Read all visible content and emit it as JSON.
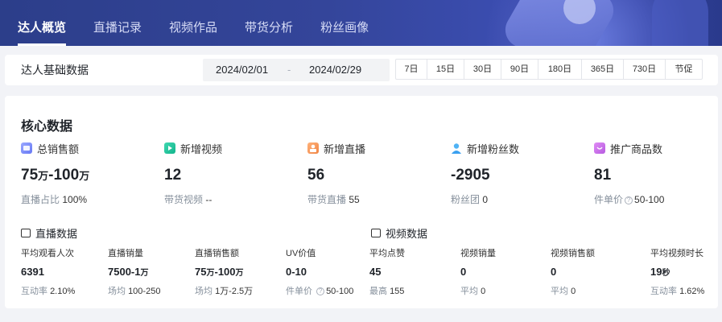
{
  "tabs": [
    "达人概览",
    "直播记录",
    "视频作品",
    "带货分析",
    "粉丝画像"
  ],
  "filter": {
    "title": "达人基础数据",
    "start_date": "2024/02/01",
    "separator": "-",
    "end_date": "2024/02/29",
    "quick_ranges": [
      "7日",
      "15日",
      "30日",
      "90日",
      "180日",
      "365日",
      "730日",
      "节促"
    ]
  },
  "core": {
    "title": "核心数据",
    "metrics": [
      {
        "label": "总销售额",
        "icon": "wallet-icon",
        "value": "75",
        "unit1": "万",
        "dash": "-",
        "value2": "100",
        "unit2": "万",
        "sub_label": "直播占比",
        "sub_value": "100%"
      },
      {
        "label": "新增视频",
        "icon": "video-icon",
        "value": "12",
        "sub_label": "带货视频",
        "sub_value": "--"
      },
      {
        "label": "新增直播",
        "icon": "live-icon",
        "value": "56",
        "sub_label": "带货直播",
        "sub_value": "55"
      },
      {
        "label": "新增粉丝数",
        "icon": "user-icon",
        "value": "-2905",
        "sub_label": "粉丝团",
        "sub_value": "0"
      },
      {
        "label": "推广商品数",
        "icon": "shop-bag-icon",
        "value": "81",
        "sub_label": "件单价",
        "sub_value": "50-100"
      }
    ]
  },
  "live": {
    "title": "直播数据",
    "items": [
      {
        "label": "平均观看人次",
        "value": "6391",
        "sub_label": "互动率",
        "sub_value": "2.10%"
      },
      {
        "label": "直播销量",
        "value": "7500-1",
        "unit": "万",
        "sub_label": "场均",
        "sub_value": "100-250"
      },
      {
        "label": "直播销售额",
        "value": "75",
        "unit1": "万",
        "dash": "-",
        "value2": "100",
        "unit2": "万",
        "sub_label": "场均",
        "sub_value": "1万-2.5万"
      },
      {
        "label": "UV价值",
        "value": "0-10",
        "sub_label": "件单价",
        "sub_value": "50-100"
      }
    ]
  },
  "video": {
    "title": "视频数据",
    "items": [
      {
        "label": "平均点赞",
        "value": "45",
        "sub_label": "最高",
        "sub_value": "155"
      },
      {
        "label": "视频销量",
        "value": "0",
        "sub_label": "平均",
        "sub_value": "0"
      },
      {
        "label": "视频销售额",
        "value": "0",
        "sub_label": "平均",
        "sub_value": "0"
      },
      {
        "label": "平均视频时长",
        "value": "19",
        "unit": "秒",
        "sub_label": "互动率",
        "sub_value": "1.62%"
      }
    ]
  }
}
